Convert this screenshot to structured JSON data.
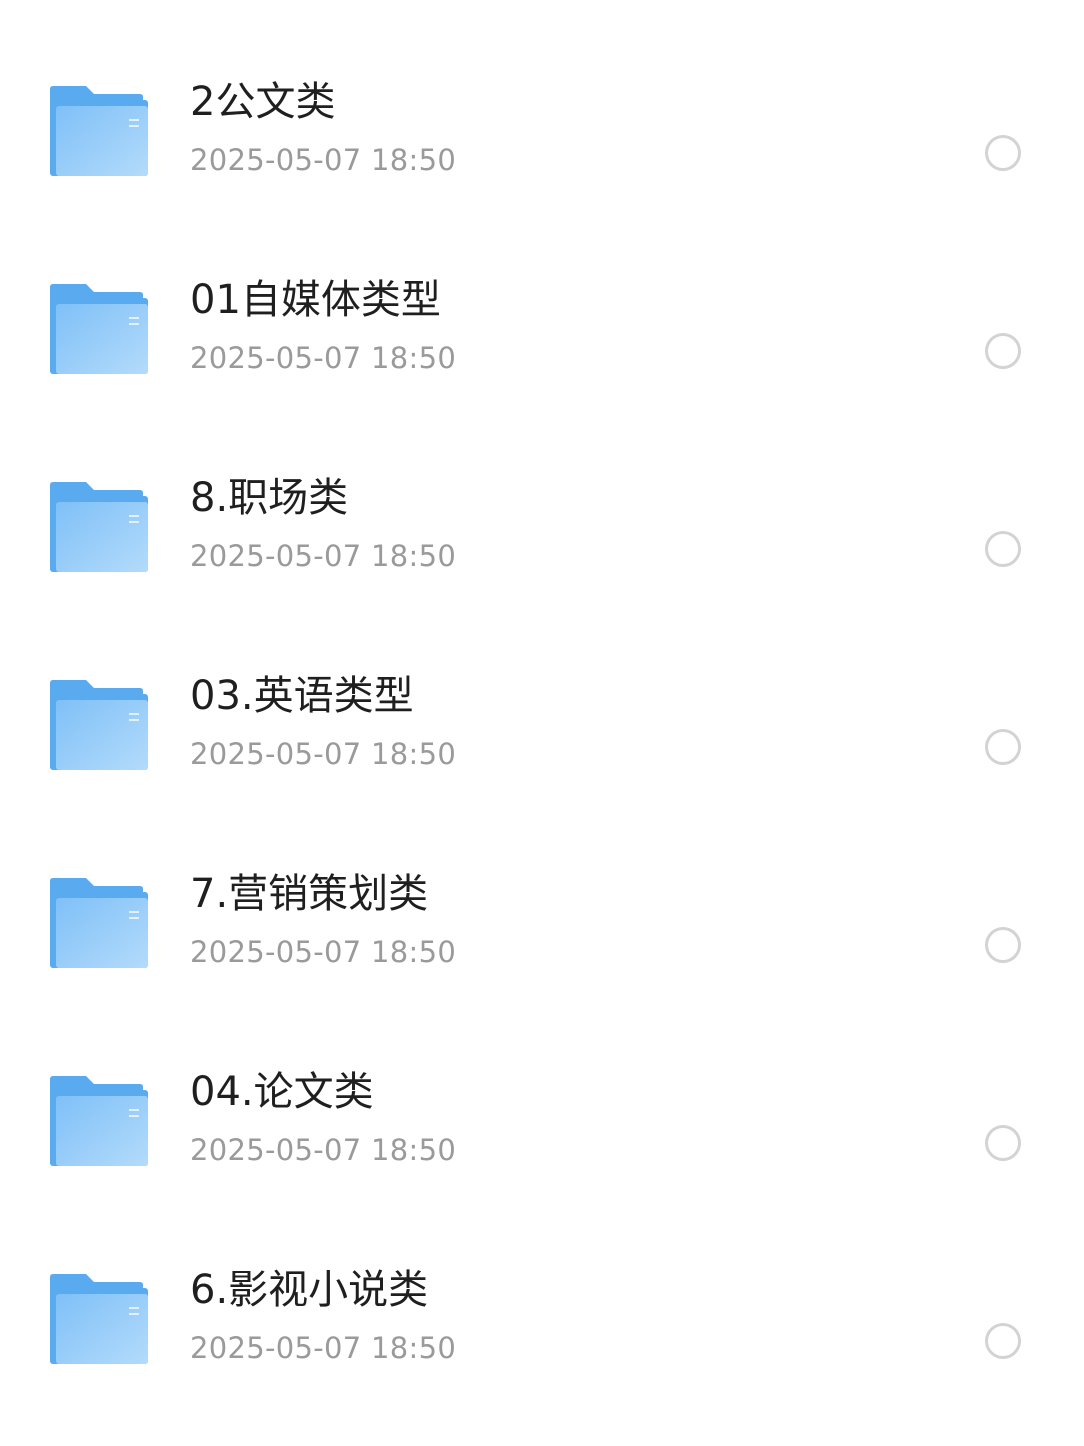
{
  "files": [
    {
      "name": "2公文类",
      "date": "2025-05-07 18:50",
      "icon": "folder-icon"
    },
    {
      "name": "01自媒体类型",
      "date": "2025-05-07 18:50",
      "icon": "folder-icon"
    },
    {
      "name": "8.职场类",
      "date": "2025-05-07 18:50",
      "icon": "folder-icon"
    },
    {
      "name": "03.英语类型",
      "date": "2025-05-07 18:50",
      "icon": "folder-icon"
    },
    {
      "name": "7.营销策划类",
      "date": "2025-05-07 18:50",
      "icon": "folder-icon"
    },
    {
      "name": "04.论文类",
      "date": "2025-05-07 18:50",
      "icon": "folder-icon"
    },
    {
      "name": "6.影视小说类",
      "date": "2025-05-07 18:50",
      "icon": "folder-icon"
    }
  ],
  "colors": {
    "folder_back": "#5aaaf0",
    "folder_front_top": "#7fc0f7",
    "folder_front_bottom": "#b3dbfb",
    "title_text": "#1f1f1f",
    "date_text": "#9a9a9a",
    "radio_border": "#d3d3d3"
  }
}
